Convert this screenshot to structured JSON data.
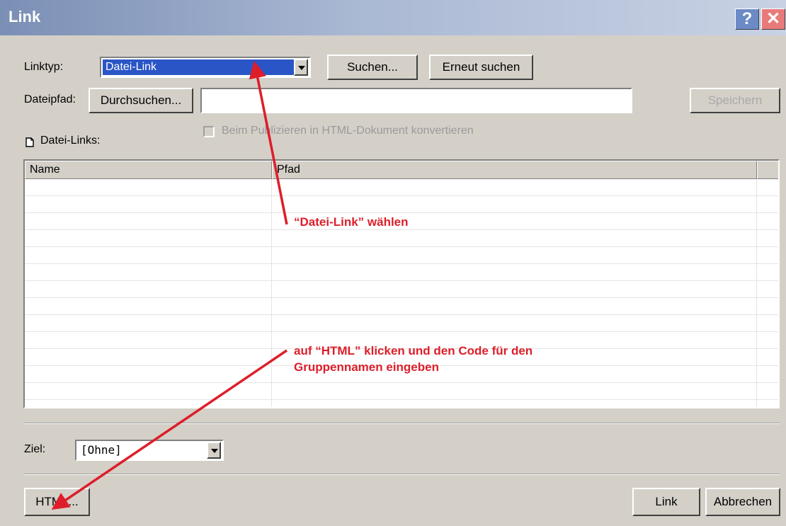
{
  "window": {
    "title": "Link",
    "help_glyph": "?",
    "close_glyph": "✕"
  },
  "linktyp": {
    "label": "Linktyp:",
    "value": "Datei-Link"
  },
  "buttons": {
    "suchen": "Suchen...",
    "erneut_suchen": "Erneut suchen",
    "durchsuchen": "Durchsuchen...",
    "speichern": "Speichern",
    "html": "HTML...",
    "link": "Link",
    "abbrechen": "Abbrechen"
  },
  "dateipfad": {
    "label": "Dateipfad:",
    "value": ""
  },
  "checkbox": {
    "label": "Beim Publizieren in HTML-Dokument konvertieren",
    "checked": false
  },
  "section": {
    "label": "Datei-Links:",
    "icon": "document-icon"
  },
  "table": {
    "columns": [
      "Name",
      "Pfad"
    ],
    "rows": []
  },
  "ziel": {
    "label": "Ziel:",
    "value": "[Ohne]"
  },
  "annotations": {
    "top": "“Datei-Link” wählen",
    "bottom_line1": "auf “HTML” klicken und den Code für den",
    "bottom_line2": "Gruppennamen eingeben"
  },
  "colors": {
    "annotation": "#dd1e2a",
    "selection": "#2a55c6",
    "titlebar_start": "#7b8fb5"
  }
}
